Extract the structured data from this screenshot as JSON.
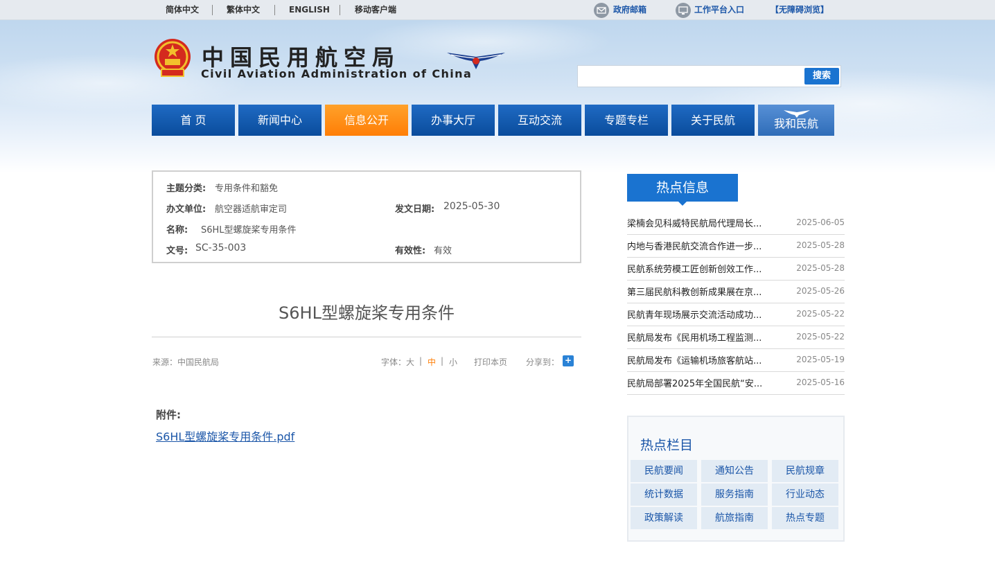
{
  "topbar": {
    "languages": [
      "简体中文",
      "繁体中文",
      "ENGLISH",
      "移动客户端"
    ],
    "links": [
      {
        "label": "政府邮箱",
        "icon": "mail-icon"
      },
      {
        "label": "工作平台入口",
        "icon": "monitor-icon"
      },
      {
        "label": "【无障碍浏览】",
        "icon": ""
      }
    ]
  },
  "header": {
    "title_cn": "中国民用航空局",
    "title_en": "Civil Aviation Administration of China",
    "search_placeholder": "",
    "search_button": "搜索"
  },
  "nav": {
    "items": [
      "首 页",
      "新闻中心",
      "信息公开",
      "办事大厅",
      "互动交流",
      "专题专栏",
      "关于民航",
      "我和民航"
    ],
    "active_index": 2
  },
  "doc_info": {
    "subject_label": "主题分类:",
    "subject_value": "专用条件和豁免",
    "office_label": "办文单位:",
    "office_value": "航空器适航审定司",
    "date_label": "发文日期:",
    "date_value": "2025-05-30",
    "name_label": "名称:",
    "name_value": "S6HL型螺旋桨专用条件",
    "number_label": "文号:",
    "number_value": "SC-35-003",
    "validity_label": "有效性:",
    "validity_value": "有效"
  },
  "article": {
    "title": "S6HL型螺旋桨专用条件",
    "source": "来源：中国民航局",
    "font_label": "字体：",
    "font_large": "大",
    "font_sep": "|",
    "font_medium": "中",
    "font_small": "小",
    "print": "打印本页",
    "share": "分享到：",
    "share_icon_glyph": "+",
    "attachment_label": "附件:",
    "attachment_link": "S6HL型螺旋桨专用条件.pdf"
  },
  "hot_info": {
    "title": "热点信息",
    "items": [
      {
        "title": "梁楠会见科威特民航局代理局长...",
        "date": "2025-06-05"
      },
      {
        "title": "内地与香港民航交流合作进一步...",
        "date": "2025-05-28"
      },
      {
        "title": "民航系统劳模工匠创新创效工作...",
        "date": "2025-05-28"
      },
      {
        "title": "第三届民航科教创新成果展在京...",
        "date": "2025-05-26"
      },
      {
        "title": "民航青年现场展示交流活动成功...",
        "date": "2025-05-22"
      },
      {
        "title": "民航局发布《民用机场工程监测...",
        "date": "2025-05-22"
      },
      {
        "title": "民航局发布《运输机场旅客航站...",
        "date": "2025-05-19"
      },
      {
        "title": "民航局部署2025年全国民航“安...",
        "date": "2025-05-16"
      }
    ]
  },
  "hot_columns": {
    "title": "热点栏目",
    "items": [
      "民航要闻",
      "通知公告",
      "民航规章",
      "统计数据",
      "服务指南",
      "行业动态",
      "政策解读",
      "航旅指南",
      "热点专题"
    ]
  },
  "colors": {
    "nav_blue": "#0a4c9c",
    "nav_active": "#ff7e06",
    "link_blue": "#1b56a8",
    "accent_blue": "#1a73d0"
  }
}
